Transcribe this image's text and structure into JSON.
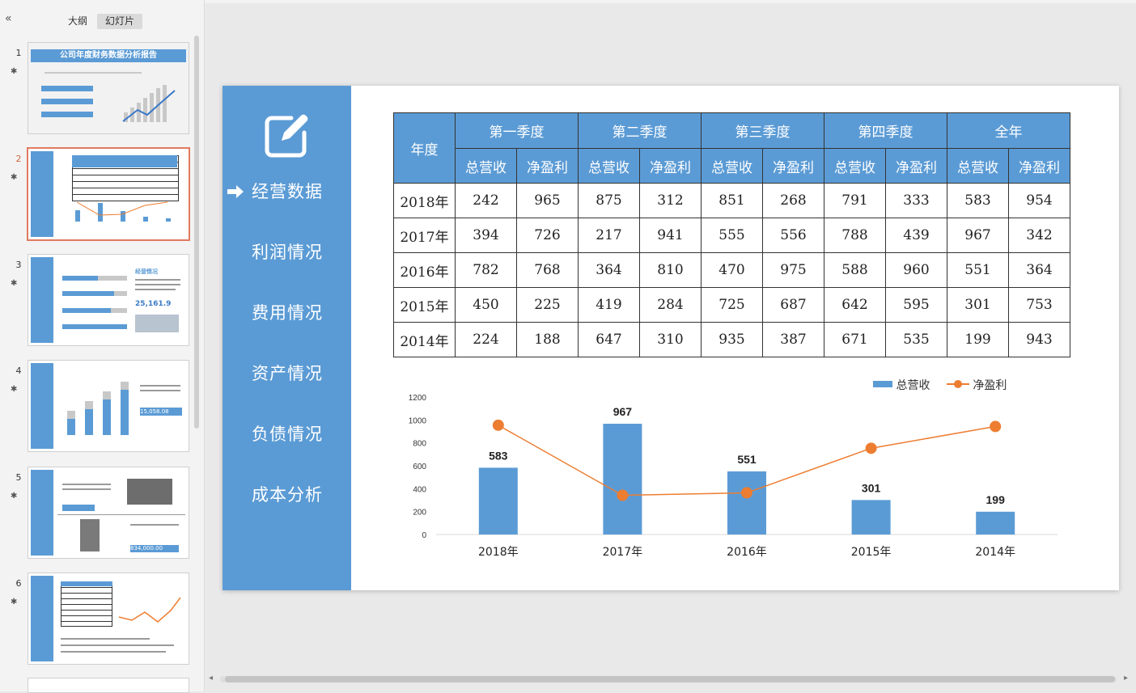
{
  "panel": {
    "tabs": {
      "outline": "大纲",
      "slides": "幻灯片"
    },
    "thumbnails": [
      {
        "num": "1",
        "title": "公司年度财务数据分析报告"
      },
      {
        "num": "2"
      },
      {
        "num": "3",
        "heading": "经营情况",
        "value": "25,161.9"
      },
      {
        "num": "4",
        "value": "15,058.08"
      },
      {
        "num": "5",
        "value": "834,000.00"
      },
      {
        "num": "6"
      }
    ]
  },
  "slide": {
    "nav": [
      "经营数据",
      "利润情况",
      "费用情况",
      "资产情况",
      "负债情况",
      "成本分析"
    ],
    "active_nav_index": 0,
    "table": {
      "year_header": "年度",
      "quarters": [
        "第一季度",
        "第二季度",
        "第三季度",
        "第四季度",
        "全年"
      ],
      "sub_headers": [
        "总营收",
        "净盈利"
      ],
      "rows": [
        {
          "year": "2018年",
          "values": [
            "242",
            "965",
            "875",
            "312",
            "851",
            "268",
            "791",
            "333",
            "583",
            "954"
          ]
        },
        {
          "year": "2017年",
          "values": [
            "394",
            "726",
            "217",
            "941",
            "555",
            "556",
            "788",
            "439",
            "967",
            "342"
          ]
        },
        {
          "year": "2016年",
          "values": [
            "782",
            "768",
            "364",
            "810",
            "470",
            "975",
            "588",
            "960",
            "551",
            "364"
          ]
        },
        {
          "year": "2015年",
          "values": [
            "450",
            "225",
            "419",
            "284",
            "725",
            "687",
            "642",
            "595",
            "301",
            "753"
          ]
        },
        {
          "year": "2014年",
          "values": [
            "224",
            "188",
            "647",
            "310",
            "935",
            "387",
            "671",
            "535",
            "199",
            "943"
          ]
        }
      ]
    }
  },
  "chart_data": {
    "type": "bar",
    "categories": [
      "2018年",
      "2017年",
      "2016年",
      "2015年",
      "2014年"
    ],
    "series": [
      {
        "name": "总营收",
        "type": "bar",
        "values": [
          583,
          967,
          551,
          301,
          199
        ],
        "color": "#5b9bd5",
        "data_labels": true
      },
      {
        "name": "净盈利",
        "type": "line",
        "values": [
          954,
          342,
          364,
          753,
          943
        ],
        "color": "#ed7d31"
      }
    ],
    "yticks": [
      "0",
      "200",
      "400",
      "600",
      "800",
      "1000",
      "1200"
    ],
    "ylim": [
      0,
      1200
    ],
    "legend": "top-right",
    "grid": false
  }
}
